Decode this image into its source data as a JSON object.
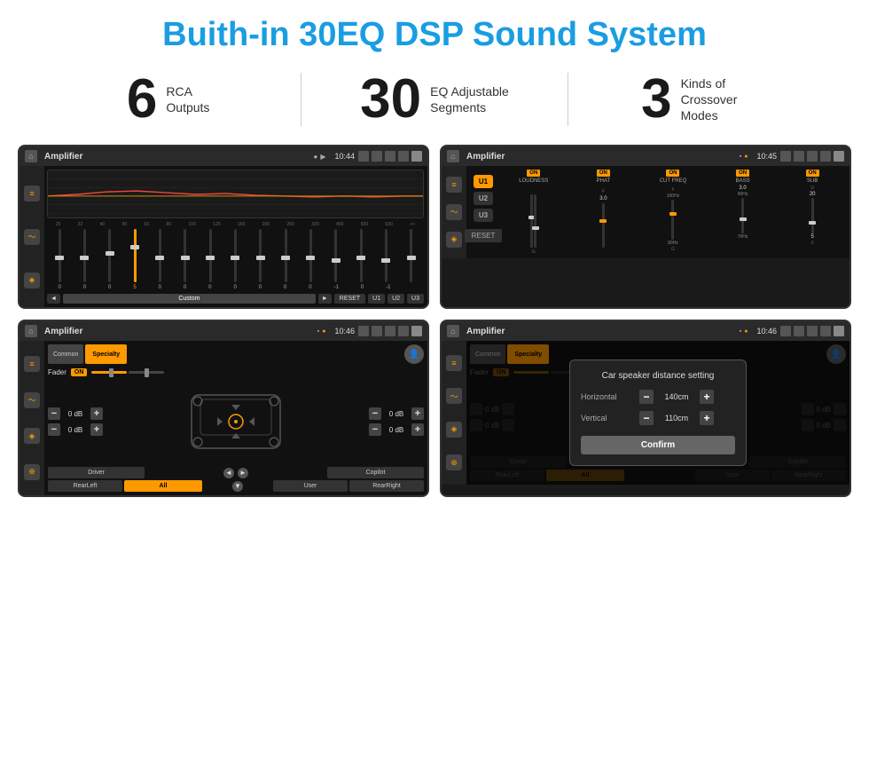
{
  "title": "Buith-in 30EQ DSP Sound System",
  "stats": [
    {
      "number": "6",
      "desc_line1": "RCA",
      "desc_line2": "Outputs"
    },
    {
      "number": "30",
      "desc_line1": "EQ Adjustable",
      "desc_line2": "Segments"
    },
    {
      "number": "3",
      "desc_line1": "Kinds of",
      "desc_line2": "Crossover Modes"
    }
  ],
  "screens": [
    {
      "id": "eq-screen",
      "time": "10:44",
      "title": "Amplifier",
      "eq_labels": [
        "25",
        "32",
        "40",
        "50",
        "63",
        "80",
        "100",
        "125",
        "160",
        "200",
        "250",
        "320",
        "400",
        "500",
        "630"
      ],
      "eq_values": [
        "0",
        "0",
        "0",
        "5",
        "0",
        "0",
        "0",
        "0",
        "0",
        "0",
        "0",
        "-1",
        "0",
        "-1",
        ""
      ],
      "eq_buttons": [
        "◄",
        "Custom",
        "►",
        "RESET",
        "U1",
        "U2",
        "U3"
      ]
    },
    {
      "id": "crossover-screen",
      "time": "10:45",
      "title": "Amplifier",
      "tabs": [
        "U1",
        "U2",
        "U3"
      ],
      "channels": [
        "LOUDNESS",
        "PHAT",
        "CUT FREQ",
        "BASS",
        "SUB"
      ]
    },
    {
      "id": "fader-screen",
      "time": "10:46",
      "title": "Amplifier",
      "tabs": [
        "Common",
        "Specialty"
      ],
      "fader_label": "Fader",
      "fader_on": "ON",
      "speaker_rows": [
        {
          "value": "0 dB"
        },
        {
          "value": "0 dB"
        },
        {
          "value": "0 dB"
        },
        {
          "value": "0 dB"
        }
      ],
      "bottom_buttons": [
        "Driver",
        "",
        "",
        "",
        "",
        "Copilot",
        "RearLeft",
        "All",
        "",
        "User",
        "RearRight"
      ]
    },
    {
      "id": "distance-screen",
      "time": "10:46",
      "title": "Amplifier",
      "dialog": {
        "title": "Car speaker distance setting",
        "rows": [
          {
            "label": "Horizontal",
            "value": "140cm"
          },
          {
            "label": "Vertical",
            "value": "110cm"
          }
        ],
        "confirm_label": "Confirm"
      },
      "bottom_buttons": [
        "Driver",
        "",
        "",
        "",
        "",
        "Copilot",
        "RearLeft",
        "All",
        "",
        "User",
        "RearRight"
      ]
    }
  ]
}
